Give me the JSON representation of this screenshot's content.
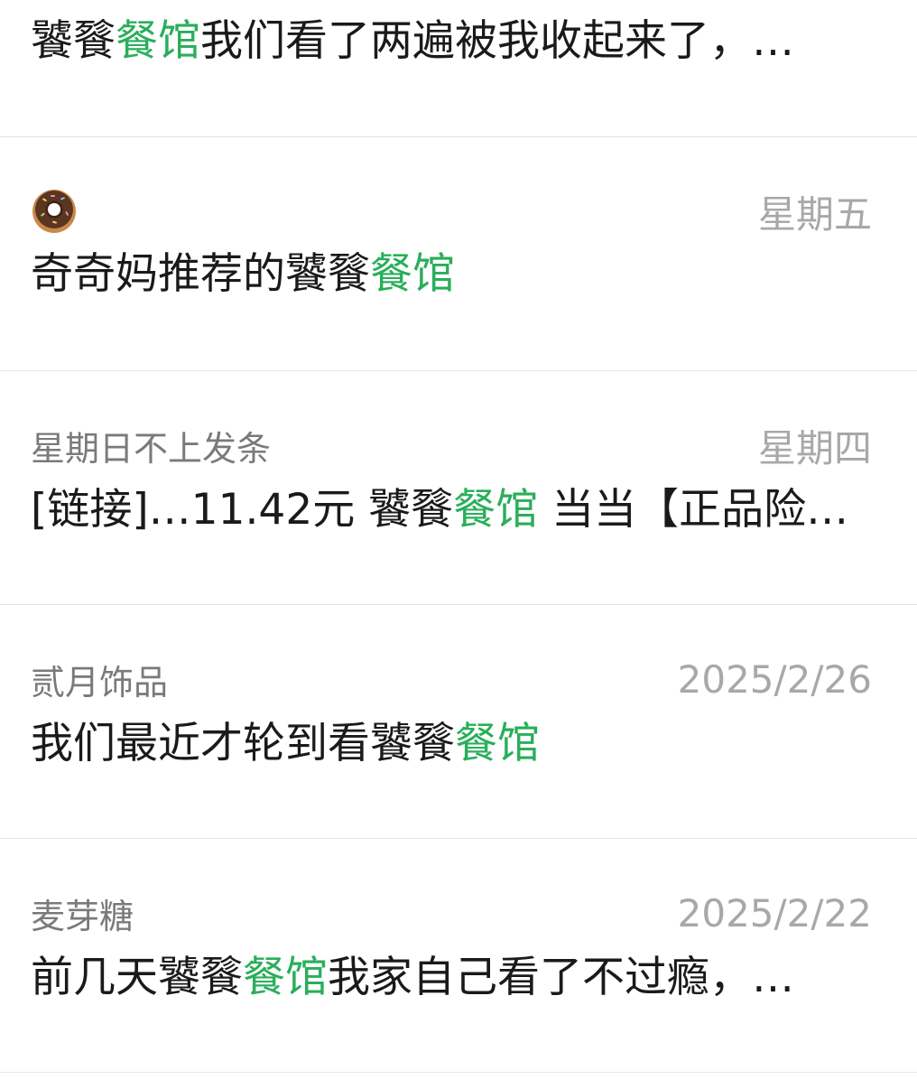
{
  "results": [
    {
      "sender": "",
      "date": "",
      "snippet_before": "饕餮",
      "keyword": "餐馆",
      "snippet_after": "我们看了两遍被我收起来了，…"
    },
    {
      "sender_icon": "donut-icon",
      "date": "星期五",
      "snippet_before": "奇奇妈推荐的饕餮",
      "keyword": "餐馆",
      "snippet_after": ""
    },
    {
      "sender": "星期日不上发条",
      "date": "星期四",
      "snippet_before": "[链接]…11.42元 饕餮",
      "keyword": "餐馆",
      "snippet_after": " 当当【正品险…"
    },
    {
      "sender": "贰月饰品",
      "date": "2025/2/26",
      "snippet_before": "我们最近才轮到看饕餮",
      "keyword": "餐馆",
      "snippet_after": ""
    },
    {
      "sender": "麦芽糖",
      "date": "2025/2/22",
      "snippet_before": "前几天饕餮",
      "keyword": "餐馆",
      "snippet_after": "我家自己看了不过瘾，…"
    }
  ],
  "colors": {
    "keyword_highlight": "#2aae5b",
    "divider": "#e5e5e5",
    "sender_text": "#7a7a7a",
    "date_text": "#a8a8a8",
    "snippet_text": "#1a1a1a"
  }
}
